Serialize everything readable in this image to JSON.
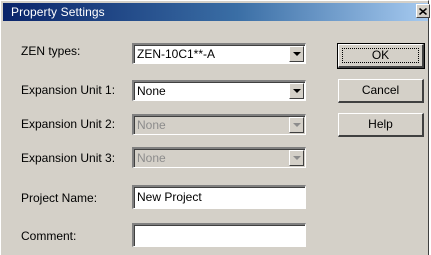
{
  "window": {
    "title": "Property Settings"
  },
  "icons": {
    "close": "close-icon",
    "dropdown": "chevron-down-icon"
  },
  "form": {
    "zen_types": {
      "label": "ZEN types:",
      "value": "ZEN-10C1**-A"
    },
    "expansion_unit_1": {
      "label": "Expansion Unit 1:",
      "value": "None"
    },
    "expansion_unit_2": {
      "label": "Expansion Unit 2:",
      "value": "None"
    },
    "expansion_unit_3": {
      "label": "Expansion Unit 3:",
      "value": "None"
    },
    "project_name": {
      "label": "Project Name:",
      "value": "New Project"
    },
    "comment": {
      "label": "Comment:",
      "value": ""
    }
  },
  "buttons": {
    "ok": "OK",
    "cancel": "Cancel",
    "help": "Help"
  },
  "colors": {
    "titlebar_start": "#0a246a",
    "titlebar_end": "#a6caf0",
    "dialog_face": "#d4d0c8"
  }
}
